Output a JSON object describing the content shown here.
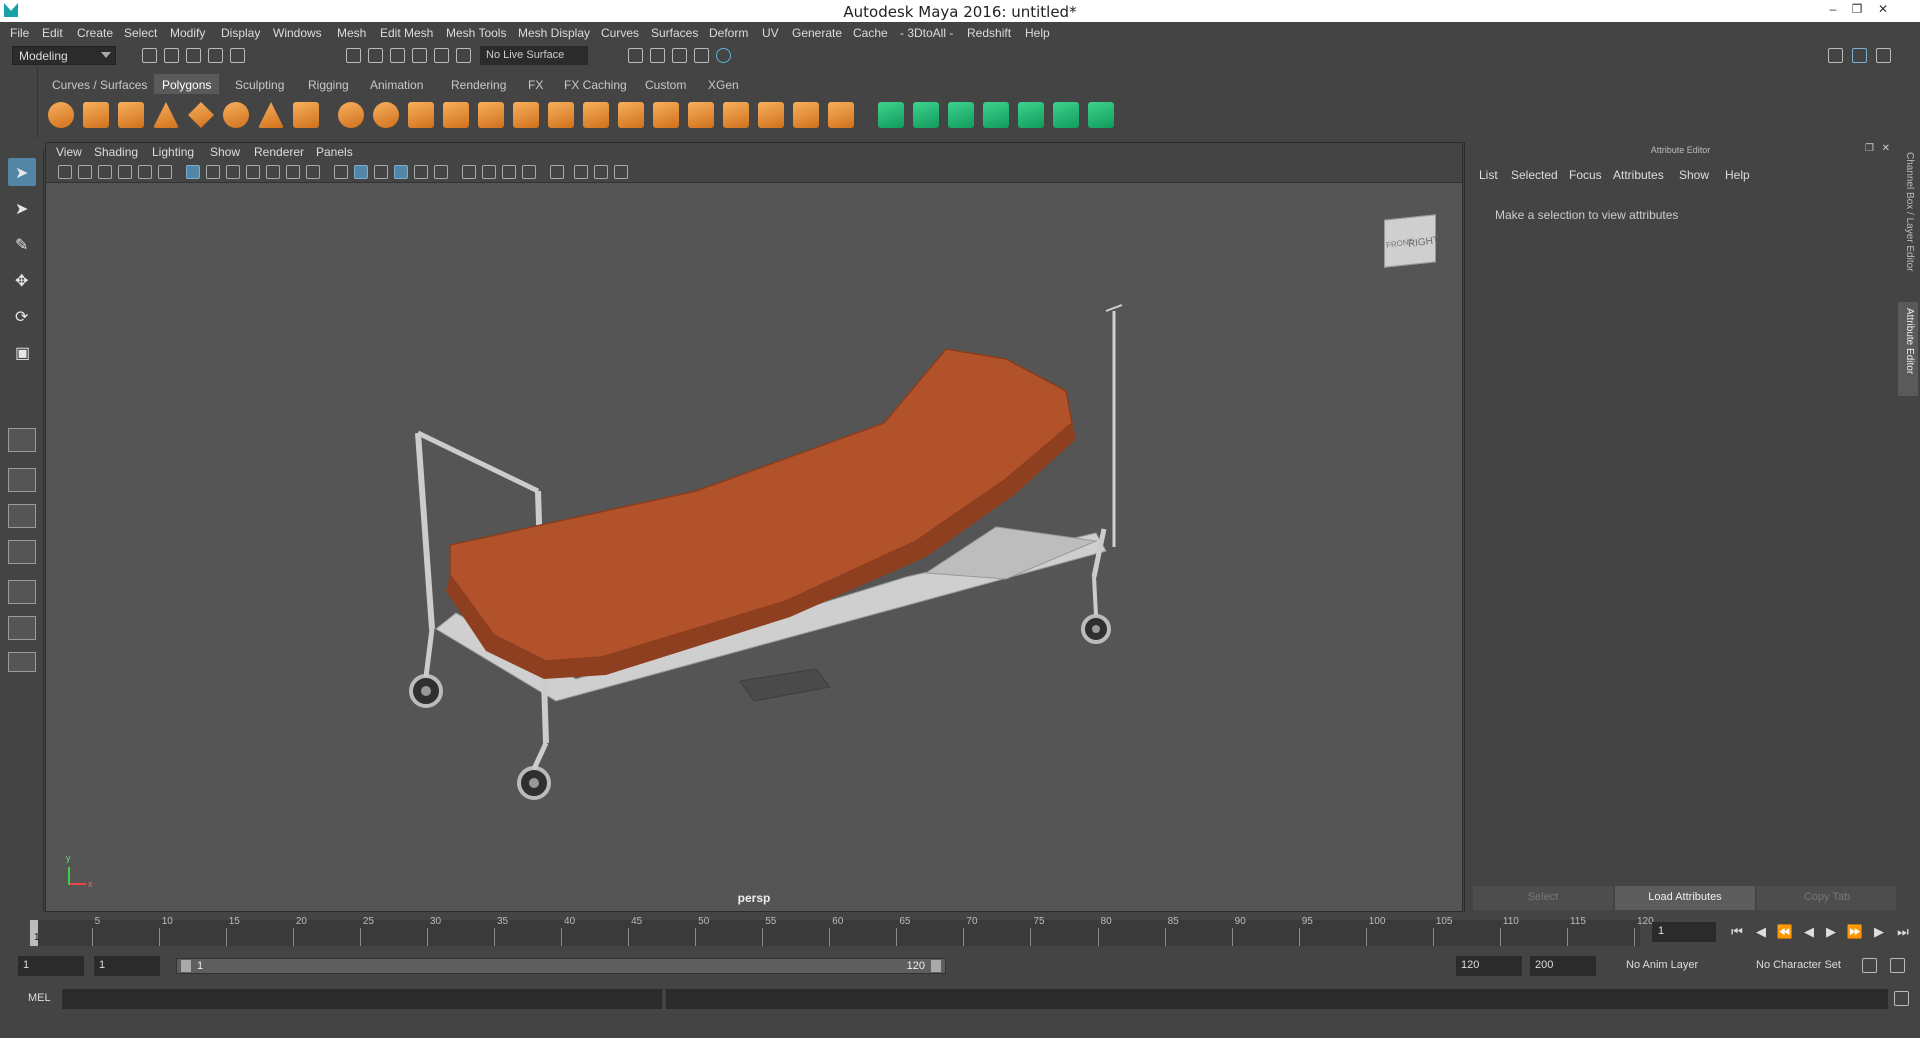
{
  "window": {
    "title": "Autodesk Maya 2016: untitled*"
  },
  "menubar": [
    "File",
    "Edit",
    "Create",
    "Select",
    "Modify",
    "Display",
    "Windows",
    "Mesh",
    "Edit Mesh",
    "Mesh Tools",
    "Mesh Display",
    "Curves",
    "Surfaces",
    "Deform",
    "UV",
    "Generate",
    "Cache",
    "- 3DtoAll -",
    "Redshift",
    "Help"
  ],
  "toolbar": {
    "mode": "Modeling",
    "live_surface": "No Live Surface"
  },
  "shelf": {
    "tabs": [
      "Curves / Surfaces",
      "Polygons",
      "Sculpting",
      "Rigging",
      "Animation",
      "Rendering",
      "FX",
      "FX Caching",
      "Custom",
      "XGen"
    ],
    "active_tab": "Polygons"
  },
  "viewport": {
    "menu": [
      "View",
      "Shading",
      "Lighting",
      "Show",
      "Renderer",
      "Panels"
    ],
    "camera": "persp",
    "viewcube_label": "RIGHT",
    "viewcube_label2": "FRONT",
    "axis_x": "x",
    "axis_y": "y"
  },
  "attribute_editor": {
    "title": "Attribute Editor",
    "menu": [
      "List",
      "Selected",
      "Focus",
      "Attributes",
      "Show",
      "Help"
    ],
    "message": "Make a selection to view attributes",
    "buttons": [
      "Select",
      "Load Attributes",
      "Copy Tab"
    ]
  },
  "side_tabs": [
    "Channel Box / Layer Editor",
    "Attribute Editor"
  ],
  "timeline": {
    "ticks": [
      5,
      10,
      15,
      20,
      25,
      30,
      35,
      40,
      45,
      50,
      55,
      60,
      65,
      70,
      75,
      80,
      85,
      90,
      95,
      100,
      105,
      110,
      115,
      120
    ],
    "current": "1",
    "current_frame_field": "1"
  },
  "range": {
    "start": "1",
    "anim_start": "1",
    "slider_start": "1",
    "slider_end": "120",
    "end": "120",
    "anim_end": "200",
    "anim_layer": "No Anim Layer",
    "character_set": "No Character Set"
  },
  "command_line": {
    "label": "MEL"
  },
  "colors": {
    "accent": "#5285a6",
    "mattress": "#b2522a",
    "frame": "#c9c9c9",
    "viewport_bg": "#555555"
  }
}
